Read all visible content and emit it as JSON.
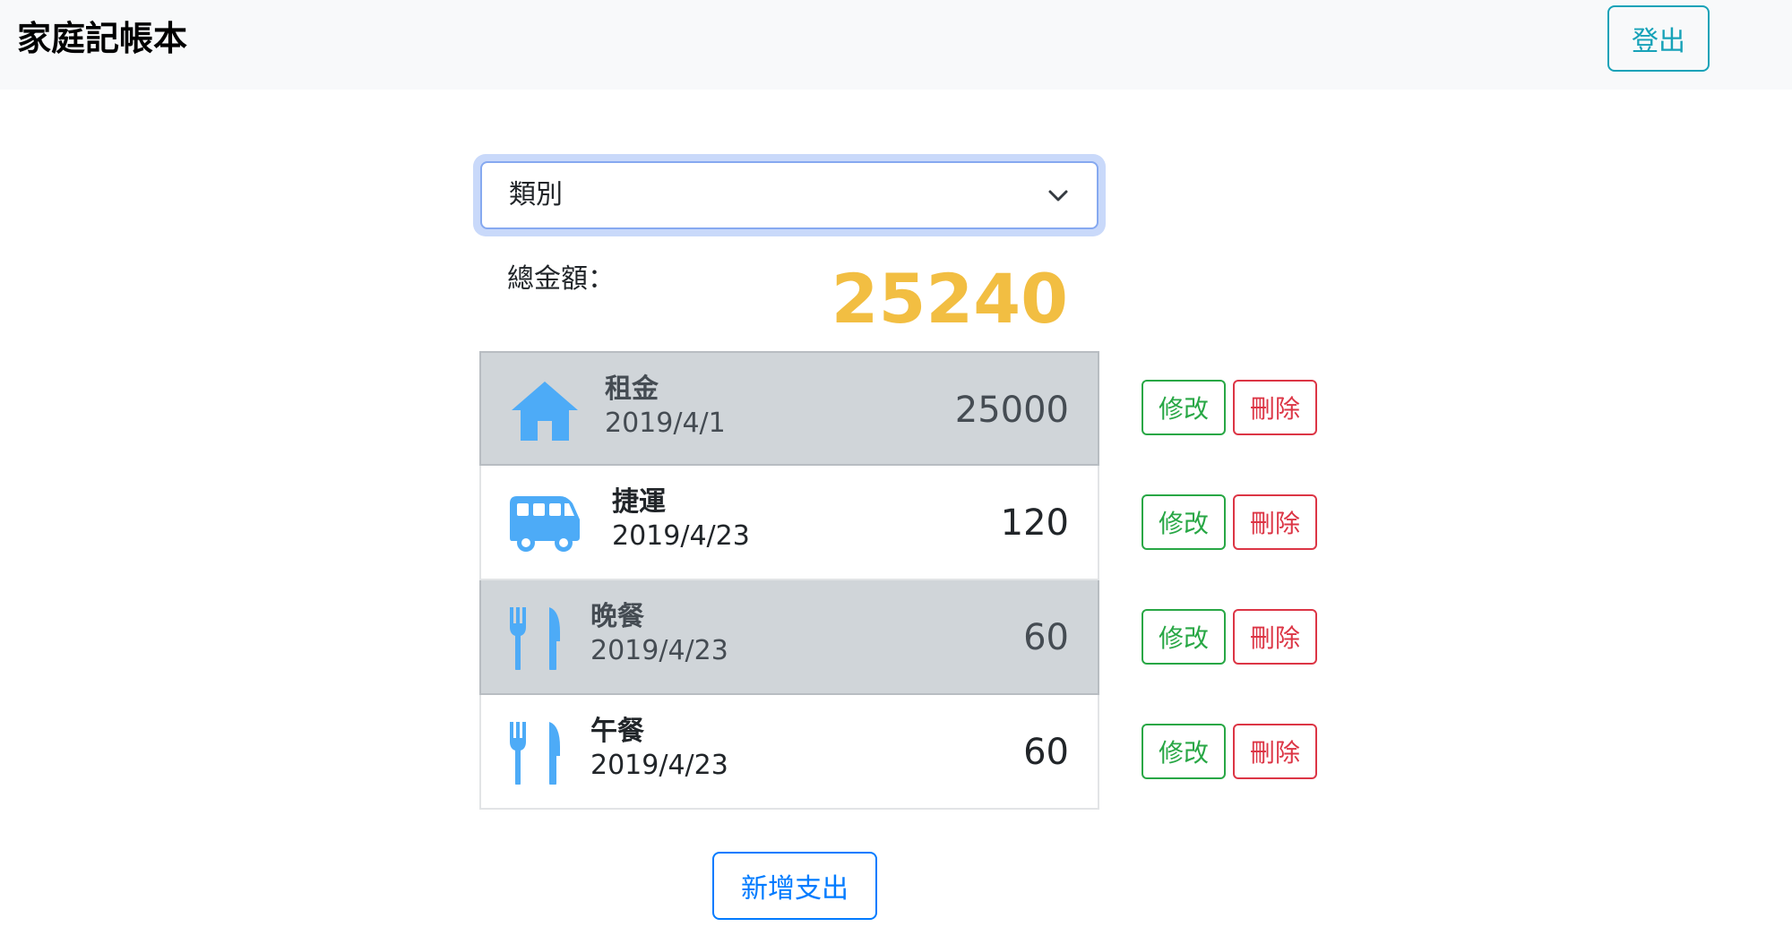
{
  "navbar": {
    "brand": "家庭記帳本",
    "logout_label": "登出"
  },
  "filter": {
    "selected": "類別"
  },
  "summary": {
    "label": "總金額：",
    "total": "25240"
  },
  "colors": {
    "icon": "#4dabf7",
    "total": "#f2be42",
    "edit": "#28a745",
    "delete": "#dc3545",
    "primary": "#007bff",
    "info": "#17a2b8"
  },
  "expenses": [
    {
      "name": "租金",
      "date": "2019/4/1",
      "amount": "25000",
      "icon": "home-icon"
    },
    {
      "name": "捷運",
      "date": "2019/4/23",
      "amount": "120",
      "icon": "bus-icon"
    },
    {
      "name": "晚餐",
      "date": "2019/4/23",
      "amount": "60",
      "icon": "utensils-icon"
    },
    {
      "name": "午餐",
      "date": "2019/4/23",
      "amount": "60",
      "icon": "utensils-icon"
    }
  ],
  "actions": {
    "edit_label": "修改",
    "delete_label": "刪除"
  },
  "add_button": {
    "label": "新增支出"
  }
}
